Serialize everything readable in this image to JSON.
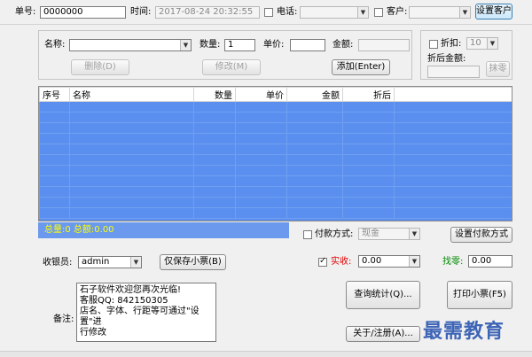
{
  "top": {
    "order_no_label": "单号:",
    "order_no_value": "0000000",
    "time_label": "时间:",
    "time_value": "2017-08-24 20:32:55",
    "phone_label": "电话:",
    "phone_value": "",
    "customer_label": "客户:",
    "customer_value": "",
    "set_customer_button": "设置客户"
  },
  "entry": {
    "name_label": "名称:",
    "name_value": "",
    "qty_label": "数量:",
    "qty_value": "1",
    "price_label": "单价:",
    "price_value": "",
    "amount_label": "金额:",
    "amount_value": "",
    "delete_button": "删除(D)",
    "modify_button": "修改(M)",
    "add_button": "添加(Enter)"
  },
  "discount": {
    "label": "折扣:",
    "value": "10",
    "after_label": "折后金额:",
    "after_value": "",
    "clear_button": "抹零"
  },
  "table": {
    "columns": [
      "序号",
      "名称",
      "数量",
      "单价",
      "金额",
      "折后"
    ],
    "rows": 11
  },
  "summary": {
    "text": "总量:0  总额:0.00"
  },
  "payment": {
    "label": "付款方式:",
    "value": "现金",
    "set_button": "设置付款方式"
  },
  "cashier": {
    "label": "收银员:",
    "value": "admin",
    "save_button": "仅保存小票(B)"
  },
  "actual": {
    "label": "实收:",
    "value": "0.00"
  },
  "change": {
    "label": "找零:",
    "value": "0.00"
  },
  "note": {
    "label": "备注:",
    "lines": [
      "石子软件欢迎您再次光临!",
      "客服QQ: 842150305",
      "店名、字体、行距等可通过\"设置\"进",
      "行修改"
    ]
  },
  "buttons": {
    "query": "查询统计(Q)...",
    "print": "打印小票(F5)",
    "about": "关于/注册(A)..."
  },
  "watermark": "最需教育",
  "colors": {
    "grid_blue": "#5b8fef",
    "summary_bg": "#6b99ee",
    "summary_text": "#ffff00",
    "actual_label": "#e00000",
    "change_label": "#008a00"
  }
}
